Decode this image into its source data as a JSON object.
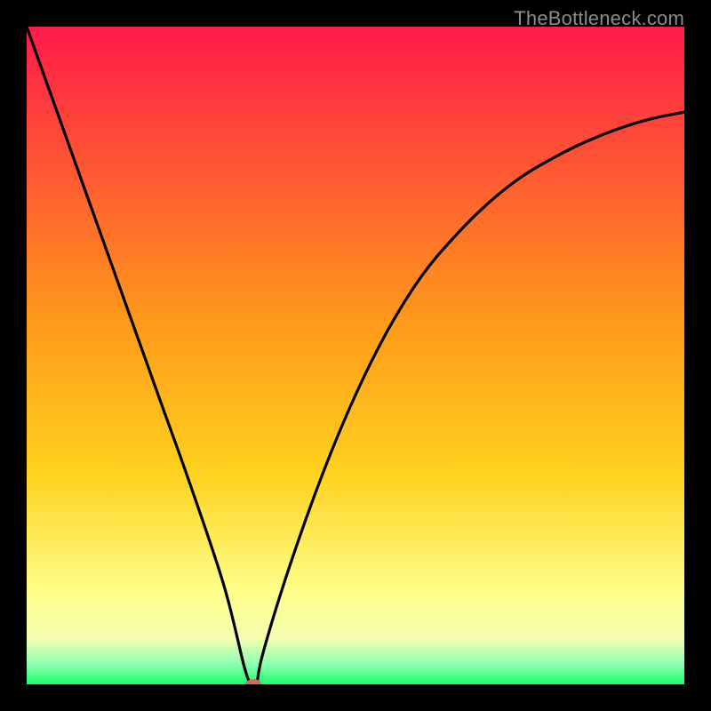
{
  "watermark": "TheBottleneck.com",
  "chart_data": {
    "type": "line",
    "title": "",
    "xlabel": "",
    "ylabel": "",
    "xlim": [
      0,
      100
    ],
    "ylim": [
      0,
      100
    ],
    "grid": false,
    "background_gradient": {
      "top_color": "#ff1a4a",
      "mid_color": "#ffd21f",
      "low_band_color": "#ffff8a",
      "bottom_color": "#1aff6a"
    },
    "series": [
      {
        "name": "bottleneck-curve",
        "color": "#000000",
        "x": [
          0,
          5,
          10,
          15,
          20,
          25,
          30,
          33,
          34,
          35,
          36,
          40,
          45,
          50,
          55,
          60,
          65,
          70,
          75,
          80,
          85,
          90,
          95,
          100
        ],
        "values": [
          100,
          86,
          72,
          58,
          44,
          30,
          15,
          3,
          0,
          0,
          5,
          18,
          32,
          44,
          54,
          62,
          68,
          73,
          77,
          80,
          82.5,
          84.5,
          86,
          87
        ]
      }
    ],
    "marker": {
      "name": "optimal-point",
      "x": 34.5,
      "y": 0,
      "color": "#d46a5a",
      "rx": 9,
      "ry": 6
    }
  }
}
